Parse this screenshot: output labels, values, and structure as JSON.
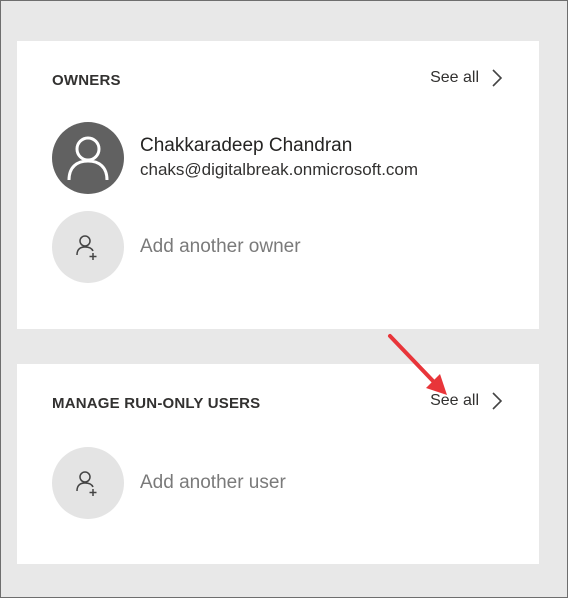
{
  "owners": {
    "title": "OWNERS",
    "see_all_label": "See all",
    "owner": {
      "name": "Chakkaradeep Chandran",
      "email": "chaks@digitalbreak.onmicrosoft.com"
    },
    "add_label": "Add another owner"
  },
  "run_only": {
    "title": "MANAGE RUN-ONLY USERS",
    "see_all_label": "See all",
    "add_label": "Add another user"
  },
  "icons": {
    "owner_avatar": "person-icon",
    "add_owner": "add-person-icon",
    "add_user": "add-person-icon",
    "see_all": "chevron-right-icon",
    "callout": "red-arrow-icon"
  },
  "colors": {
    "callout_arrow": "#e8353a",
    "background": "#e8e8e8",
    "card": "#ffffff",
    "avatar_dark": "#616161",
    "avatar_light": "#e4e4e4"
  }
}
